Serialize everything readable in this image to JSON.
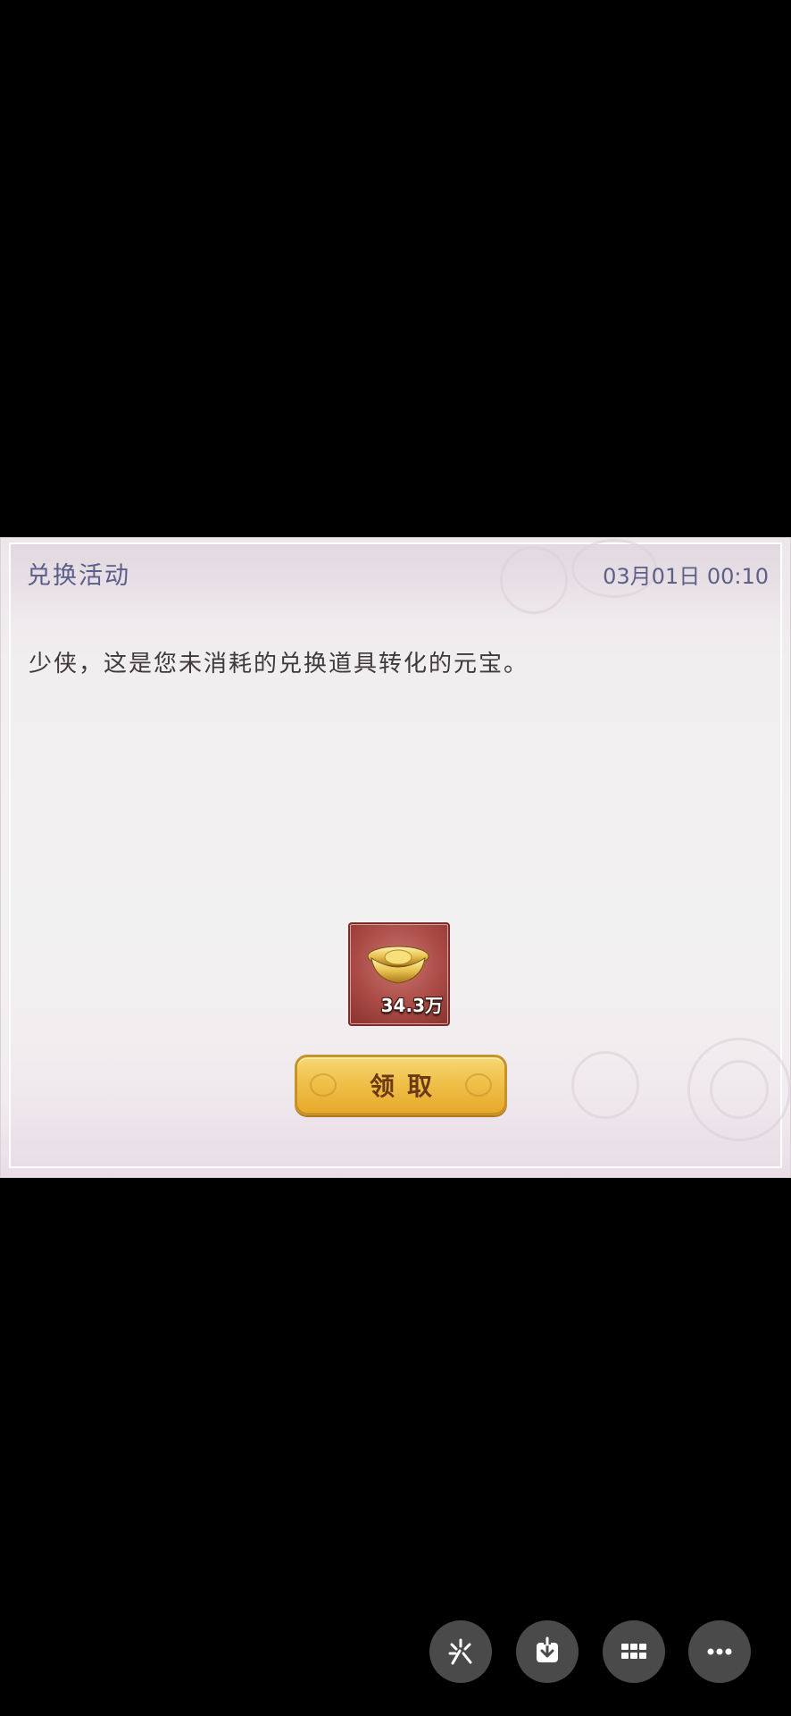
{
  "mail": {
    "title": "兑换活动",
    "date": "03月01日  00:10",
    "body": "少侠，这是您未消耗的兑换道具转化的元宝。"
  },
  "reward": {
    "icon": "gold-ingot-icon",
    "amount": "34.3万"
  },
  "claim_button": {
    "label": "领取"
  },
  "toolbar": {
    "buttons": [
      {
        "icon": "magic-enhance-icon"
      },
      {
        "icon": "download-icon"
      },
      {
        "icon": "grid-apps-icon"
      },
      {
        "icon": "more-icon"
      }
    ]
  },
  "colors": {
    "title": "#5a5f8a",
    "button_gold": "#f0c14a",
    "reward_bg": "#ab4b46"
  }
}
